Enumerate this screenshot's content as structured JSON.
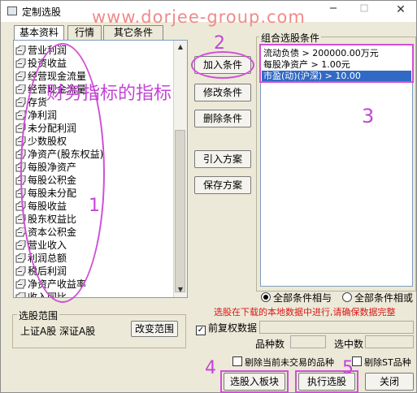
{
  "window": {
    "title": "定制选股",
    "watermark": "www.dorjee-group.com",
    "minimize_icon": "minimize-icon",
    "maximize_icon": "maximize-icon",
    "close_glyph": "✕"
  },
  "tabs": [
    "基本资料",
    "行情",
    "其它条件"
  ],
  "indicators": [
    "营业利润",
    "投资收益",
    "经营现金流量",
    "经营现金流量",
    "存货",
    "净利润",
    "未分配利润",
    "少数股权",
    "净资产(股东权益)",
    "每股净资产",
    "每股公积金",
    "每股未分配",
    "每股收益",
    "股东权益比",
    "资本公积金",
    "营业收入",
    "利润总额",
    "税后利润",
    "净资产收益率",
    "收入同比"
  ],
  "side_buttons": {
    "add": "加入条件",
    "modify": "修改条件",
    "delete": "删除条件",
    "import": "引入方案",
    "save": "保存方案"
  },
  "conditions": {
    "group_label": "组合选股条件",
    "items": [
      {
        "text": "流动负债 > 200000.00万元",
        "selected": false
      },
      {
        "text": "每股净资产 > 1.00元",
        "selected": false
      },
      {
        "text": "市盈(动)(沪深) > 10.00",
        "selected": true
      }
    ]
  },
  "radio_options": {
    "all_and": "全部条件相与",
    "all_or": "全部条件相或",
    "selected": "all_and"
  },
  "notice": "选股在下载的本地数据中进行,请确保数据完整",
  "range": {
    "label": "选股范围",
    "markets": "上证A股 深证A股",
    "change_button": "改变范围"
  },
  "front_adjust": {
    "label": "前复权数据",
    "checked": true
  },
  "counts": {
    "total_label": "品种数",
    "selected_label": "选中数",
    "total_value": "",
    "selected_value": ""
  },
  "exclude": {
    "untraded": "剔除当前未交易的品种",
    "st": "剔除ST品种",
    "untraded_checked": false,
    "st_checked": false
  },
  "bottom_buttons": {
    "to_block": "选股入板块",
    "execute": "执行选股",
    "close": "关闭"
  },
  "annotations": {
    "fin_indicator_note": "财务指标的指标",
    "num1": "1",
    "num2": "2",
    "num3": "3",
    "num4": "4",
    "num5": "5"
  },
  "colors": {
    "annotation": "#c445d6",
    "selection": "#316ac5",
    "notice": "#d81818",
    "watermark": "#f08a8a"
  }
}
